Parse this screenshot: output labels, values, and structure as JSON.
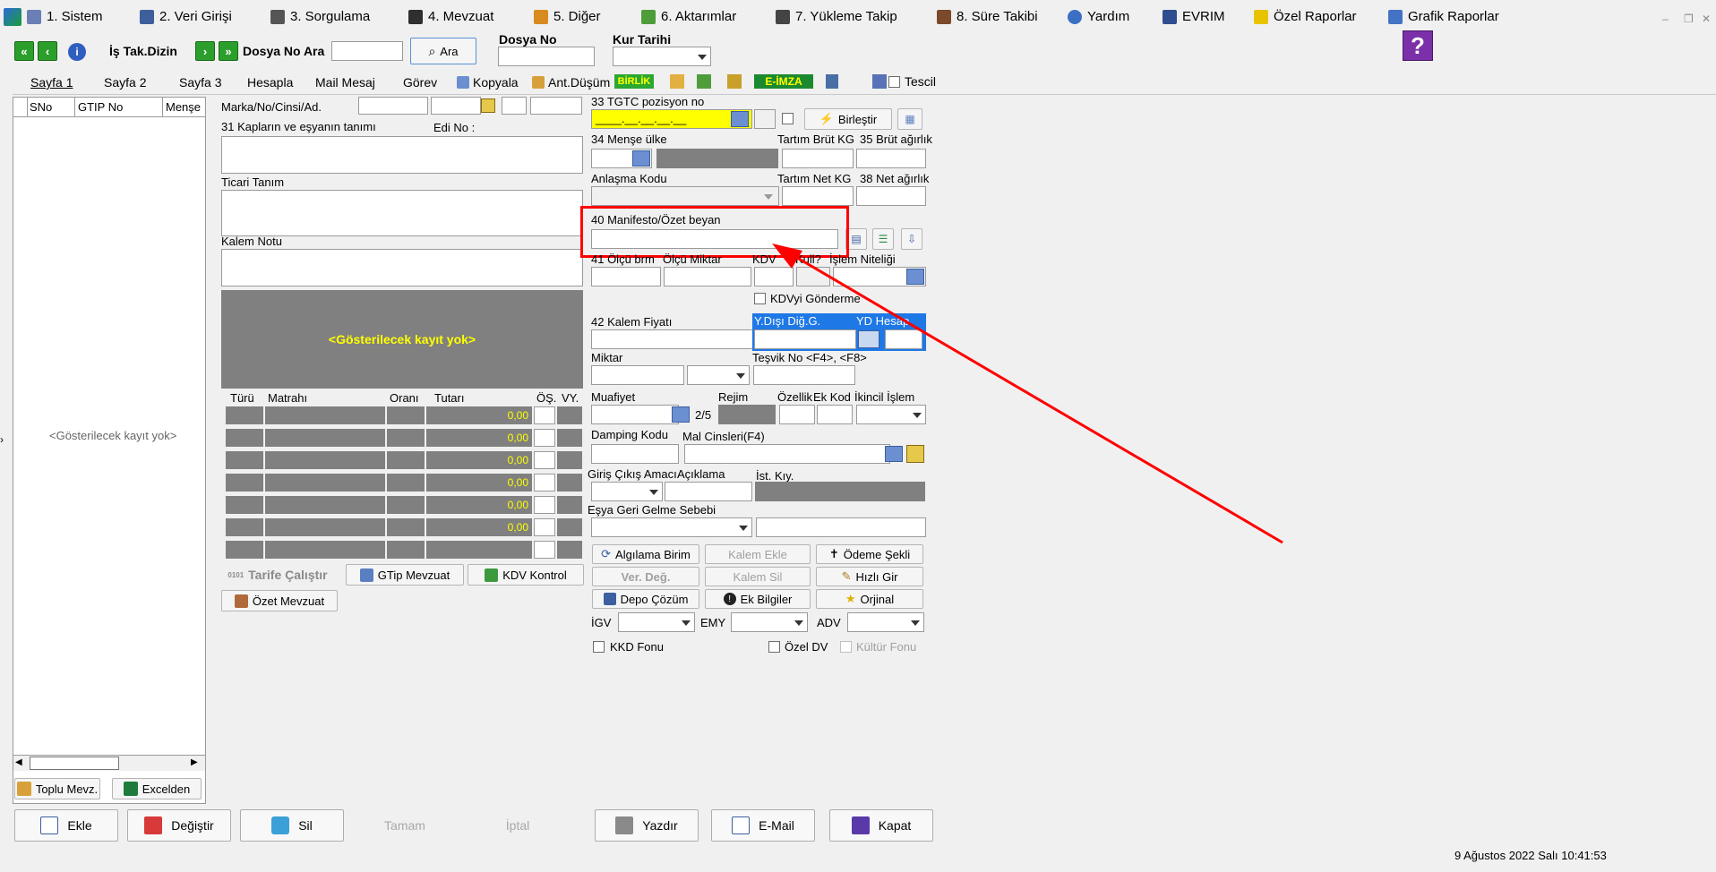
{
  "menu": {
    "items": [
      "1.  Sistem",
      "2.  Veri Girişi",
      "3.  Sorgulama",
      "4.  Mevzuat",
      "5.  Diğer",
      "6.  Aktarımlar",
      "7.  Yükleme Takip",
      "8. Süre Takibi",
      "Yardım",
      "EVRIM",
      "Özel Raporlar",
      "Grafik Raporlar"
    ]
  },
  "toolbar": {
    "is_takip_label": "İş Tak.Dizin",
    "dosya_no_ara_label": "Dosya No Ara",
    "ara_button": "Ara",
    "dosya_no_label": "Dosya No",
    "kur_tarihi_label": "Kur Tarihi",
    "help_glyph": "?"
  },
  "tabs": {
    "items": [
      "Sayfa 1",
      "Sayfa 2",
      "Sayfa 3",
      "Hesapla",
      "Mail Mesaj",
      "Görev",
      "Kopyala",
      "Ant.Düşüm",
      "BİRLİK",
      "E-İMZA",
      "Tescil"
    ]
  },
  "left_panel": {
    "columns": [
      "SNo",
      "GTIP No",
      "Menşe"
    ],
    "empty_text": "<Gösterilecek kayıt yok>",
    "toplu_mevz_button": "Toplu Mevz.",
    "excelden_button": "Excelden"
  },
  "middle": {
    "marka_label": "Marka/No/Cinsi/Ad.",
    "kaplar_label": "31 Kapların ve eşyanın tanımı",
    "edi_no_label": "Edi No :",
    "ticari_tanim_label": "Ticari Tanım",
    "kalem_notu_label": "Kalem Notu",
    "empty_grid_text": "<Gösterilecek kayıt yok>",
    "tax_columns": [
      "Türü",
      "Matrahı",
      "Oranı",
      "Tutarı",
      "ÖŞ.",
      "VY."
    ],
    "tax_values": [
      "0,00",
      "0,00",
      "0,00",
      "0,00",
      "0,00",
      "0,00"
    ],
    "tarife_calistir_button": "Tarife Çalıştır",
    "gtip_mevzuat_button": "GTip Mevzuat",
    "kdv_kontrol_button": "KDV Kontrol",
    "ozet_mevzuat_button": "Özet Mevzuat"
  },
  "right": {
    "gtc_label": "33 TGTC pozisyon no",
    "gtc_mask": "____.__.__.__.__",
    "birlestir_button": "Birleştir",
    "mense_ulke_label": "34 Menşe ülke",
    "tartim_brut_label": "Tartım Brüt KG",
    "brut_agirlik_label": "35 Brüt ağırlık",
    "anlasma_kodu_label": "Anlaşma Kodu",
    "tartim_net_label": "Tartım Net KG",
    "net_agirlik_label": "38 Net ağırlık",
    "manifesto_label": "40 Manifesto/Özet beyan",
    "olcu_birimi_label": "41 Ölçü brm",
    "olcu_miktar_label": "Ölçü Miktar",
    "kdv_label": "KDV",
    "kull_label": "Kull?",
    "islem_niteligi_label": "İşlem Niteliği",
    "kdvyi_gonderme_label": "KDVyi Gönderme",
    "kalem_fiyati_label": "42 Kalem Fiyatı",
    "ydisi_dig_label": "Y.Dışı Diğ.G.",
    "yd_hesap_label": "YD Hesap",
    "miktar_label": "Miktar",
    "tesvik_no_label": "Teşvik No <F4>, <F8>",
    "muafiyet_label": "Muafiyet",
    "rejim_label": "Rejim",
    "ozellik_label": "Özellik",
    "ek_kod_label": "Ek Kod",
    "ikincil_islem_label": "İkincil İşlem",
    "muafiyet_count": "2/5",
    "damping_kodu_label": "Damping Kodu",
    "mal_cinsleri_label": "Mal Cinsleri(F4)",
    "giris_cikis_label": "Giriş Çıkış Amacı",
    "aciklama_label": "Açıklama",
    "ist_kiy_label": "İst. Kıy.",
    "esya_geri_label": "Eşya Geri Gelme Sebebi",
    "algilama_birim_button": "Algılama Birim",
    "kalem_ekle_button": "Kalem Ekle",
    "odeme_sekli_button": "Ödeme Şekli",
    "ver_deg_button": "Ver. Değ.",
    "kalem_sil_button": "Kalem Sil",
    "hizli_gir_button": "Hızlı Gir",
    "depo_cozum_button": "Depo Çözüm",
    "ek_bilgiler_button": "Ek Bilgiler",
    "orjinal_button": "Orjinal",
    "igv_label": "İGV",
    "emy_label": "EMY",
    "adv_label": "ADV",
    "kkd_fonu_label": "KKD Fonu",
    "ozel_dv_label": "Özel DV",
    "kultur_fonu_label": "Kültür Fonu"
  },
  "bottom": {
    "ekle": "Ekle",
    "degistir": "Değiştir",
    "sil": "Sil",
    "tamam": "Tamam",
    "iptal": "İptal",
    "yazdir": "Yazdır",
    "email": "E-Mail",
    "kapat": "Kapat"
  },
  "status": {
    "datetime": "9 Ağustos 2022 Salı 10:41:53"
  },
  "colors": {
    "annotation_red": "#ff0000",
    "field_yellow": "#ffff00",
    "grid_gray": "#808080",
    "selection_blue": "#1e78e6"
  }
}
